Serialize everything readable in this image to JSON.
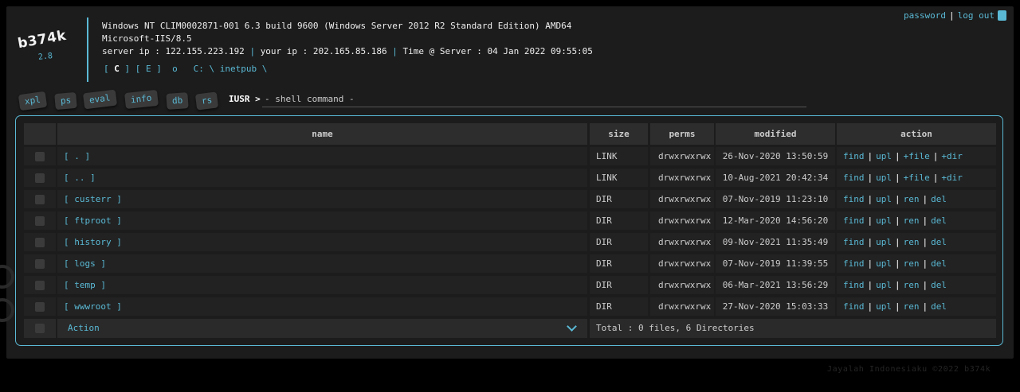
{
  "brand": {
    "name": "b374k",
    "version": "2.8"
  },
  "sysinfo": {
    "os": "Windows NT CLIM0002871-001 6.3 build 9600 (Windows Server 2012 R2 Standard Edition) AMD64",
    "software": "Microsoft-IIS/8.5",
    "server_ip_label": "server ip : 122.155.223.192",
    "your_ip_label": "your ip : 202.165.85.186",
    "time_label": "Time @ Server : 04 Jan 2022 09:55:05",
    "separator": "|"
  },
  "path": {
    "drives": [
      "C",
      "E"
    ],
    "open_bracket": "[",
    "close_bracket": "]",
    "root_marker": "o",
    "current": "C: \\ inetpub \\"
  },
  "toplinks": {
    "password": "password",
    "separator": "|",
    "logout": "log out"
  },
  "tabs": [
    "xpl",
    "ps",
    "eval",
    "info",
    "db",
    "rs"
  ],
  "prompt": {
    "label": "IUSR >",
    "placeholder": "- shell command -"
  },
  "table": {
    "headers": {
      "name": "name",
      "size": "size",
      "perms": "perms",
      "modified": "modified",
      "action": "action"
    },
    "rows": [
      {
        "name": "[ . ]",
        "size": "LINK",
        "perms": "drwxrwxrwx",
        "modified": "26-Nov-2020 13:50:59",
        "actions": [
          "find",
          "upl",
          "+file",
          "+dir"
        ]
      },
      {
        "name": "[ .. ]",
        "size": "LINK",
        "perms": "drwxrwxrwx",
        "modified": "10-Aug-2021 20:42:34",
        "actions": [
          "find",
          "upl",
          "+file",
          "+dir"
        ]
      },
      {
        "name": "[ custerr ]",
        "size": "DIR",
        "perms": "drwxrwxrwx",
        "modified": "07-Nov-2019 11:23:10",
        "actions": [
          "find",
          "upl",
          "ren",
          "del"
        ]
      },
      {
        "name": "[ ftproot ]",
        "size": "DIR",
        "perms": "drwxrwxrwx",
        "modified": "12-Mar-2020 14:56:20",
        "actions": [
          "find",
          "upl",
          "ren",
          "del"
        ]
      },
      {
        "name": "[ history ]",
        "size": "DIR",
        "perms": "drwxrwxrwx",
        "modified": "09-Nov-2021 11:35:49",
        "actions": [
          "find",
          "upl",
          "ren",
          "del"
        ]
      },
      {
        "name": "[ logs ]",
        "size": "DIR",
        "perms": "drwxrwxrwx",
        "modified": "07-Nov-2019 11:39:55",
        "actions": [
          "find",
          "upl",
          "ren",
          "del"
        ]
      },
      {
        "name": "[ temp ]",
        "size": "DIR",
        "perms": "drwxrwxrwx",
        "modified": "06-Mar-2021 13:56:29",
        "actions": [
          "find",
          "upl",
          "ren",
          "del"
        ]
      },
      {
        "name": "[ wwwroot ]",
        "size": "DIR",
        "perms": "drwxrwxrwx",
        "modified": "27-Nov-2020 15:03:33",
        "actions": [
          "find",
          "upl",
          "ren",
          "del"
        ]
      }
    ],
    "action_separator": "|",
    "footer": {
      "action_select": "Action",
      "total": "Total : 0 files, 6 Directories"
    }
  },
  "copyright": "Jayalah Indonesiaku ©2022 b374k",
  "colors": {
    "accent": "#5ab9d5",
    "panel_bg": "#1c1c1c",
    "row_bg": "#222222",
    "page_bg": "#000000"
  },
  "icons": {
    "settings": "square-settings-icon",
    "select_caret": "chevron-down-icon"
  }
}
